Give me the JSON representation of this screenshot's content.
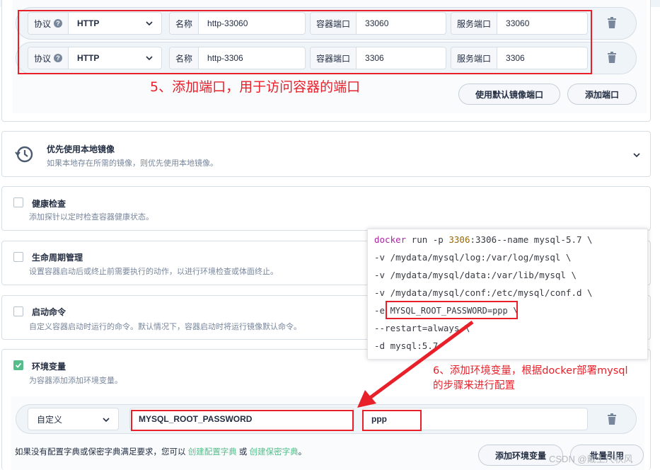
{
  "port_rows": [
    {
      "protocol_label": "协议",
      "protocol_value": "HTTP",
      "name_label": "名称",
      "name_value": "http-33060",
      "container_port_label": "容器端口",
      "container_port_value": "33060",
      "service_port_label": "服务端口",
      "service_port_value": "33060"
    },
    {
      "protocol_label": "协议",
      "protocol_value": "HTTP",
      "name_label": "名称",
      "name_value": "http-3306",
      "container_port_label": "容器端口",
      "container_port_value": "3306",
      "service_port_label": "服务端口",
      "service_port_value": "3306"
    }
  ],
  "annotations": {
    "step5": "5、添加端口，用于访问容器的端口",
    "step6_line1": "6、添加环境变量，根据docker部署mysql",
    "step6_line2": "的步骤来进行配置"
  },
  "port_buttons": {
    "use_default": "使用默认镜像端口",
    "add_port": "添加端口"
  },
  "sections": {
    "local_image": {
      "title": "优先使用本地镜像",
      "desc": "如果本地存在所需的镜像，则优先使用本地镜像。"
    },
    "health_check": {
      "title": "健康检查",
      "desc": "添加探针以定时检查容器健康状态。"
    },
    "lifecycle": {
      "title": "生命周期管理",
      "desc": "设置容器启动后或终止前需要执行的动作，以进行环境检查或体面终止。"
    },
    "start_command": {
      "title": "启动命令",
      "desc": "自定义容器启动时运行的命令。默认情况下，容器启动时将运行镜像默认命令。"
    },
    "env_vars": {
      "title": "环境变量",
      "desc": "为容器添加添加环境变量。"
    }
  },
  "code": {
    "line1_cmd": "docker",
    "line1_rest_a": " run -p ",
    "line1_port": "3306",
    "line1_rest_b": ":3306--name mysql-5.7 \\",
    "line2": "-v /mydata/mysql/log:/var/log/mysql \\",
    "line3": "-v /mydata/mysql/data:/var/lib/mysql \\",
    "line4": "-v /mydata/mysql/conf:/etc/mysql/conf.d \\",
    "line5_prefix": "-e ",
    "line5_env": "MYSQL_ROOT_PASSWORD=ppp",
    "line5_suffix": " \\",
    "line6": "--restart=always \\",
    "line7": "-d mysql:5.7"
  },
  "env_row": {
    "source_value": "自定义",
    "key_value": "MYSQL_ROOT_PASSWORD",
    "value_value": "ppp"
  },
  "footer": {
    "text_a": "如果没有配置字典或保密字典满足要求，您可以 ",
    "link_config": "创建配置字典",
    "text_b": " 或 ",
    "link_secret": "创建保密字典",
    "text_c": "。",
    "add_env_button": "添加环境变量",
    "batch_button": "批量引用"
  },
  "watermark": "CSDN @戴上尺秋风",
  "colors": {
    "annotation_red": "#e8202a",
    "checkbox_green": "#55bc8a",
    "link_green": "#55bc8a"
  }
}
